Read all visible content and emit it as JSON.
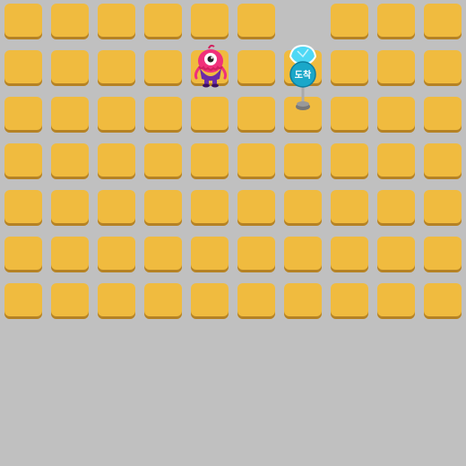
{
  "board": {
    "columns": 10,
    "rows": 7,
    "missing_tiles": [
      [
        0,
        6
      ]
    ],
    "tile_color": "#f0bb3f",
    "tile_shadow_color": "#b58225",
    "background_color": "#c0c0c0"
  },
  "player": {
    "row": 1,
    "col": 4,
    "icon": "pink-one-eyed-monster-icon",
    "colors": {
      "body": "#f0307a",
      "eye": "#ffffff",
      "pupil": "#222222",
      "clothes": "#6a2aa8"
    }
  },
  "goal": {
    "row": 1,
    "col": 6,
    "label": "도착",
    "icon": "goal-sign-icon",
    "colors": {
      "sign": "#1aa7c9",
      "crystal": "#4fd8f5",
      "pole": "#aaaaaa"
    }
  }
}
